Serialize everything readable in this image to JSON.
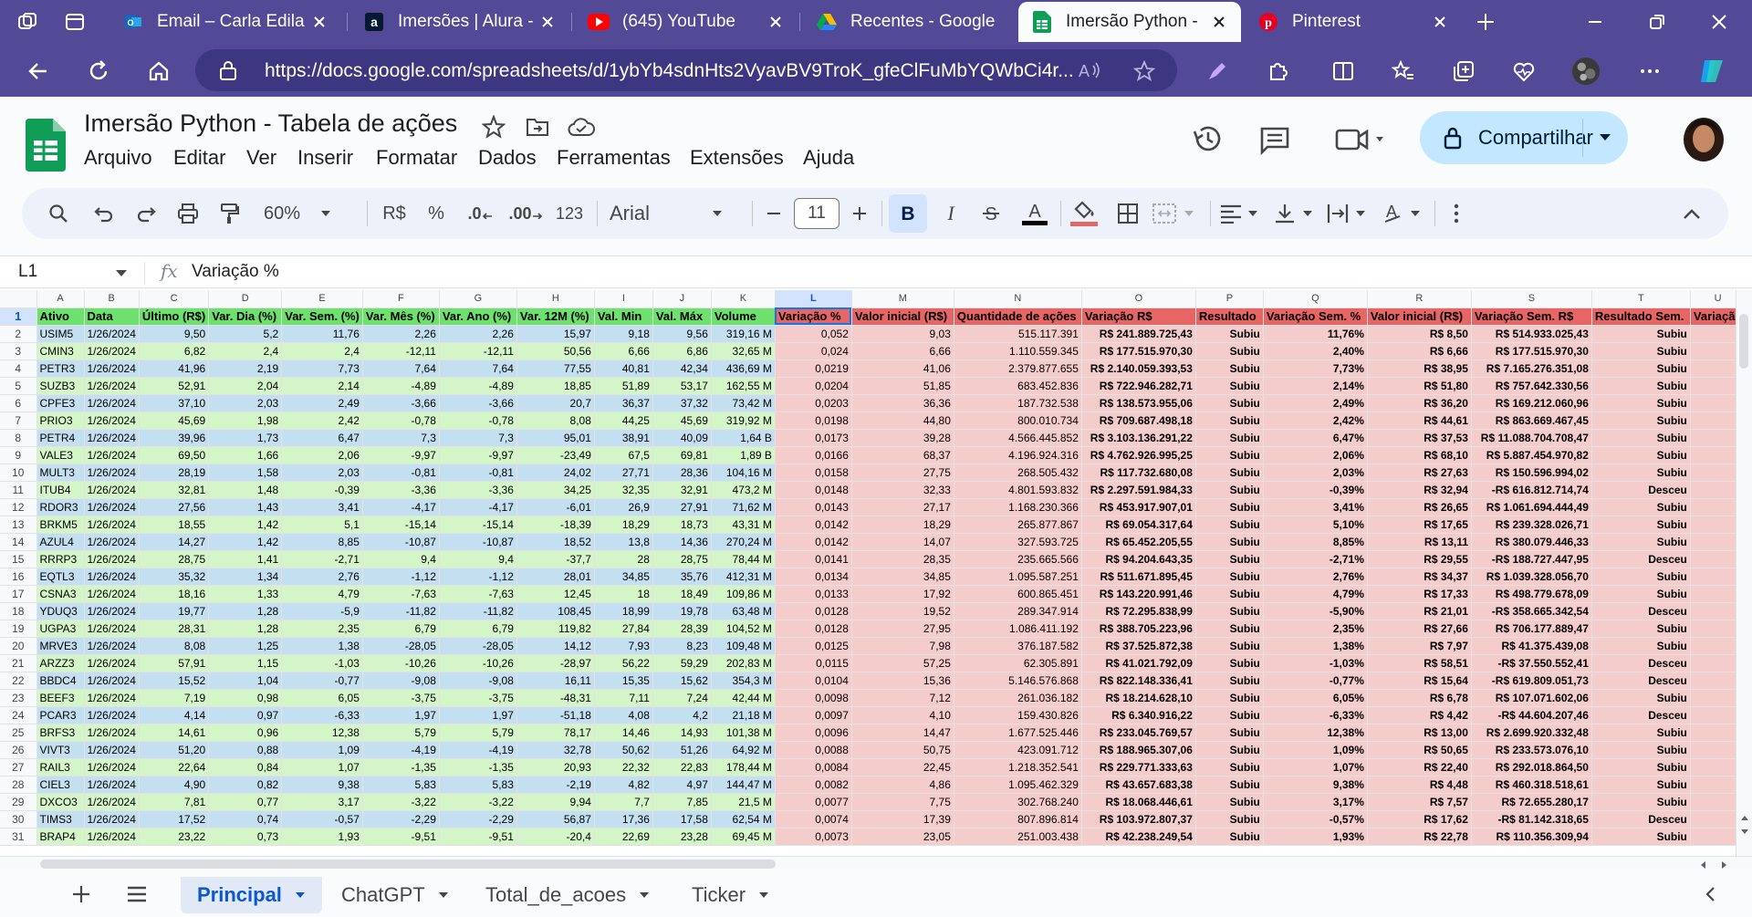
{
  "browser": {
    "tabs": [
      {
        "label": "Email – Carla Edila",
        "icon": "outlook-icon"
      },
      {
        "label": "Imersões | Alura - ",
        "icon": "alura-icon"
      },
      {
        "label": "(645) YouTube",
        "icon": "youtube-icon"
      },
      {
        "label": "Recentes - Google",
        "icon": "drive-icon"
      },
      {
        "label": "Imersão Python - ",
        "icon": "sheets-icon"
      },
      {
        "label": "Pinterest",
        "icon": "pinterest-icon"
      }
    ],
    "url": "https://docs.google.com/spreadsheets/d/1ybYb4sdnHts2VyavBV9TroK_gfeClFuMbYQWbCi4r..."
  },
  "doc": {
    "title": "Imersão Python - Tabela de ações",
    "menu": [
      "Arquivo",
      "Editar",
      "Ver",
      "Inserir",
      "Formatar",
      "Dados",
      "Ferramentas",
      "Extensões",
      "Ajuda"
    ],
    "share_label": "Compartilhar"
  },
  "toolbar": {
    "zoom": "60%",
    "currency": "R$",
    "percent": "%",
    "dec_less": ".0",
    "dec_more": ".00",
    "format_123": "123",
    "font": "Arial",
    "font_size": "11"
  },
  "formula_bar": {
    "cell_ref": "L1",
    "fx": "fx",
    "content": "Variação %"
  },
  "columns": [
    "A",
    "B",
    "C",
    "D",
    "E",
    "F",
    "G",
    "H",
    "I",
    "J",
    "K",
    "L",
    "M",
    "N",
    "O",
    "P",
    "Q",
    "R",
    "S",
    "T",
    "U"
  ],
  "headers": [
    "Ativo",
    "Data",
    "Último (R$)",
    "Var. Dia (%)",
    "Var. Sem. (%)",
    "Var. Mês (%)",
    "Var. Ano (%)",
    "Var. 12M (%)",
    "Val. Min",
    "Val. Máx",
    "Volume",
    "Variação %",
    "Valor inicial (R$)",
    "Quantidade de ações",
    "Variação R$",
    "Resultado",
    "Variação Sem. %",
    "Valor inicial (R$)",
    "Variação Sem. R$",
    "Resultado Sem.",
    "Variação"
  ],
  "rows": [
    [
      "USIM5",
      "1/26/2024",
      "9,50",
      "5,2",
      "11,76",
      "2,26",
      "2,26",
      "15,97",
      "9,18",
      "9,56",
      "319,16 M",
      "0,052",
      "9,03",
      "515.117.391",
      "R$ 241.889.725,43",
      "Subiu",
      "11,76%",
      "R$ 8,50",
      "R$ 514.933.025,43",
      "Subiu"
    ],
    [
      "CMIN3",
      "1/26/2024",
      "6,82",
      "2,4",
      "2,4",
      "-12,11",
      "-12,11",
      "50,56",
      "6,66",
      "6,86",
      "32,65 M",
      "0,024",
      "6,66",
      "1.110.559.345",
      "R$ 177.515.970,30",
      "Subiu",
      "2,40%",
      "R$ 6,66",
      "R$ 177.515.970,30",
      "Subiu"
    ],
    [
      "PETR3",
      "1/26/2024",
      "41,96",
      "2,19",
      "7,73",
      "7,64",
      "7,64",
      "77,55",
      "40,81",
      "42,34",
      "436,69 M",
      "0,0219",
      "41,06",
      "2.379.877.655",
      "R$ 2.140.059.393,53",
      "Subiu",
      "7,73%",
      "R$ 38,95",
      "R$ 7.165.276.351,08",
      "Subiu"
    ],
    [
      "SUZB3",
      "1/26/2024",
      "52,91",
      "2,04",
      "2,14",
      "-4,89",
      "-4,89",
      "18,85",
      "51,89",
      "53,17",
      "162,55 M",
      "0,0204",
      "51,85",
      "683.452.836",
      "R$ 722.946.282,71",
      "Subiu",
      "2,14%",
      "R$ 51,80",
      "R$ 757.642.330,56",
      "Subiu"
    ],
    [
      "CPFE3",
      "1/26/2024",
      "37,10",
      "2,03",
      "2,49",
      "-3,66",
      "-3,66",
      "20,7",
      "36,37",
      "37,32",
      "73,42 M",
      "0,0203",
      "36,36",
      "187.732.538",
      "R$ 138.573.955,06",
      "Subiu",
      "2,49%",
      "R$ 36,20",
      "R$ 169.212.060,96",
      "Subiu"
    ],
    [
      "PRIO3",
      "1/26/2024",
      "45,69",
      "1,98",
      "2,42",
      "-0,78",
      "-0,78",
      "8,08",
      "44,25",
      "45,69",
      "319,92 M",
      "0,0198",
      "44,80",
      "800.010.734",
      "R$ 709.687.498,18",
      "Subiu",
      "2,42%",
      "R$ 44,61",
      "R$ 863.669.467,45",
      "Subiu"
    ],
    [
      "PETR4",
      "1/26/2024",
      "39,96",
      "1,73",
      "6,47",
      "7,3",
      "7,3",
      "95,01",
      "38,91",
      "40,09",
      "1,64 B",
      "0,0173",
      "39,28",
      "4.566.445.852",
      "R$ 3.103.136.291,22",
      "Subiu",
      "6,47%",
      "R$ 37,53",
      "R$ 11.088.704.708,47",
      "Subiu"
    ],
    [
      "VALE3",
      "1/26/2024",
      "69,50",
      "1,66",
      "2,06",
      "-9,97",
      "-9,97",
      "-23,49",
      "67,5",
      "69,81",
      "1,89 B",
      "0,0166",
      "68,37",
      "4.196.924.316",
      "R$ 4.762.926.995,25",
      "Subiu",
      "2,06%",
      "R$ 68,10",
      "R$ 5.887.454.970,82",
      "Subiu"
    ],
    [
      "MULT3",
      "1/26/2024",
      "28,19",
      "1,58",
      "2,03",
      "-0,81",
      "-0,81",
      "24,02",
      "27,71",
      "28,36",
      "104,16 M",
      "0,0158",
      "27,75",
      "268.505.432",
      "R$ 117.732.680,08",
      "Subiu",
      "2,03%",
      "R$ 27,63",
      "R$ 150.596.994,02",
      "Subiu"
    ],
    [
      "ITUB4",
      "1/26/2024",
      "32,81",
      "1,48",
      "-0,39",
      "-3,36",
      "-3,36",
      "34,25",
      "32,35",
      "32,91",
      "473,2 M",
      "0,0148",
      "32,33",
      "4.801.593.832",
      "R$ 2.297.591.984,33",
      "Subiu",
      "-0,39%",
      "R$ 32,94",
      "-R$ 616.812.714,74",
      "Desceu"
    ],
    [
      "RDOR3",
      "1/26/2024",
      "27,56",
      "1,43",
      "3,41",
      "-4,17",
      "-4,17",
      "-6,01",
      "26,9",
      "27,91",
      "71,62 M",
      "0,0143",
      "27,17",
      "1.168.230.366",
      "R$ 453.917.907,01",
      "Subiu",
      "3,41%",
      "R$ 26,65",
      "R$ 1.061.694.444,49",
      "Subiu"
    ],
    [
      "BRKM5",
      "1/26/2024",
      "18,55",
      "1,42",
      "5,1",
      "-15,14",
      "-15,14",
      "-18,39",
      "18,29",
      "18,73",
      "43,31 M",
      "0,0142",
      "18,29",
      "265.877.867",
      "R$ 69.054.317,64",
      "Subiu",
      "5,10%",
      "R$ 17,65",
      "R$ 239.328.026,71",
      "Subiu"
    ],
    [
      "AZUL4",
      "1/26/2024",
      "14,27",
      "1,42",
      "8,85",
      "-10,87",
      "-10,87",
      "18,52",
      "13,8",
      "14,36",
      "270,24 M",
      "0,0142",
      "14,07",
      "327.593.725",
      "R$ 65.452.205,55",
      "Subiu",
      "8,85%",
      "R$ 13,11",
      "R$ 380.079.446,33",
      "Subiu"
    ],
    [
      "RRRP3",
      "1/26/2024",
      "28,75",
      "1,41",
      "-2,71",
      "9,4",
      "9,4",
      "-37,7",
      "28",
      "28,75",
      "78,44 M",
      "0,0141",
      "28,35",
      "235.665.566",
      "R$ 94.204.643,35",
      "Subiu",
      "-2,71%",
      "R$ 29,55",
      "-R$ 188.727.447,95",
      "Desceu"
    ],
    [
      "EQTL3",
      "1/26/2024",
      "35,32",
      "1,34",
      "2,76",
      "-1,12",
      "-1,12",
      "28,01",
      "34,85",
      "35,76",
      "412,31 M",
      "0,0134",
      "34,85",
      "1.095.587.251",
      "R$ 511.671.895,45",
      "Subiu",
      "2,76%",
      "R$ 34,37",
      "R$ 1.039.328.056,70",
      "Subiu"
    ],
    [
      "CSNA3",
      "1/26/2024",
      "18,16",
      "1,33",
      "4,79",
      "-7,63",
      "-7,63",
      "12,45",
      "18",
      "18,49",
      "109,86 M",
      "0,0133",
      "17,92",
      "600.865.451",
      "R$ 143.220.991,46",
      "Subiu",
      "4,79%",
      "R$ 17,33",
      "R$ 498.779.678,09",
      "Subiu"
    ],
    [
      "YDUQ3",
      "1/26/2024",
      "19,77",
      "1,28",
      "-5,9",
      "-11,82",
      "-11,82",
      "108,45",
      "18,99",
      "19,78",
      "63,48 M",
      "0,0128",
      "19,52",
      "289.347.914",
      "R$ 72.295.838,99",
      "Subiu",
      "-5,90%",
      "R$ 21,01",
      "-R$ 358.665.342,54",
      "Desceu"
    ],
    [
      "UGPA3",
      "1/26/2024",
      "28,31",
      "1,28",
      "2,35",
      "6,79",
      "6,79",
      "119,82",
      "27,84",
      "28,39",
      "104,52 M",
      "0,0128",
      "27,95",
      "1.086.411.192",
      "R$ 388.705.223,96",
      "Subiu",
      "2,35%",
      "R$ 27,66",
      "R$ 706.177.889,47",
      "Subiu"
    ],
    [
      "MRVE3",
      "1/26/2024",
      "8,08",
      "1,25",
      "1,38",
      "-28,05",
      "-28,05",
      "14,12",
      "7,93",
      "8,23",
      "109,48 M",
      "0,0125",
      "7,98",
      "376.187.582",
      "R$ 37.525.872,38",
      "Subiu",
      "1,38%",
      "R$ 7,97",
      "R$ 41.375.439,08",
      "Subiu"
    ],
    [
      "ARZZ3",
      "1/26/2024",
      "57,91",
      "1,15",
      "-1,03",
      "-10,26",
      "-10,26",
      "-28,97",
      "56,22",
      "59,29",
      "202,83 M",
      "0,0115",
      "57,25",
      "62.305.891",
      "R$ 41.021.792,09",
      "Subiu",
      "-1,03%",
      "R$ 58,51",
      "-R$ 37.550.552,41",
      "Desceu"
    ],
    [
      "BBDC4",
      "1/26/2024",
      "15,52",
      "1,04",
      "-0,77",
      "-9,08",
      "-9,08",
      "16,11",
      "15,35",
      "15,62",
      "354,3 M",
      "0,0104",
      "15,36",
      "5.146.576.868",
      "R$ 822.148.336,41",
      "Subiu",
      "-0,77%",
      "R$ 15,64",
      "-R$ 619.809.051,73",
      "Desceu"
    ],
    [
      "BEEF3",
      "1/26/2024",
      "7,19",
      "0,98",
      "6,05",
      "-3,75",
      "-3,75",
      "-48,31",
      "7,11",
      "7,24",
      "42,44 M",
      "0,0098",
      "7,12",
      "261.036.182",
      "R$ 18.214.628,10",
      "Subiu",
      "6,05%",
      "R$ 6,78",
      "R$ 107.071.602,06",
      "Subiu"
    ],
    [
      "PCAR3",
      "1/26/2024",
      "4,14",
      "0,97",
      "-6,33",
      "1,97",
      "1,97",
      "-51,18",
      "4,08",
      "4,2",
      "21,18 M",
      "0,0097",
      "4,10",
      "159.430.826",
      "R$ 6.340.916,22",
      "Subiu",
      "-6,33%",
      "R$ 4,42",
      "-R$ 44.604.207,46",
      "Desceu"
    ],
    [
      "BRFS3",
      "1/26/2024",
      "14,61",
      "0,96",
      "12,38",
      "5,79",
      "5,79",
      "78,17",
      "14,46",
      "14,93",
      "101,38 M",
      "0,0096",
      "14,47",
      "1.677.525.446",
      "R$ 233.045.769,57",
      "Subiu",
      "12,38%",
      "R$ 13,00",
      "R$ 2.699.920.332,48",
      "Subiu"
    ],
    [
      "VIVT3",
      "1/26/2024",
      "51,20",
      "0,88",
      "1,09",
      "-4,19",
      "-4,19",
      "32,78",
      "50,62",
      "51,26",
      "64,92 M",
      "0,0088",
      "50,75",
      "423.091.712",
      "R$ 188.965.307,06",
      "Subiu",
      "1,09%",
      "R$ 50,65",
      "R$ 233.573.076,10",
      "Subiu"
    ],
    [
      "RAIL3",
      "1/26/2024",
      "22,64",
      "0,84",
      "1,07",
      "-1,35",
      "-1,35",
      "20,93",
      "22,32",
      "22,83",
      "178,44 M",
      "0,0084",
      "22,45",
      "1.218.352.541",
      "R$ 229.771.333,63",
      "Subiu",
      "1,07%",
      "R$ 22,40",
      "R$ 292.018.864,50",
      "Subiu"
    ],
    [
      "CIEL3",
      "1/26/2024",
      "4,90",
      "0,82",
      "9,38",
      "5,83",
      "5,83",
      "-2,19",
      "4,82",
      "4,97",
      "144,47 M",
      "0,0082",
      "4,86",
      "1.095.462.329",
      "R$ 43.657.683,38",
      "Subiu",
      "9,38%",
      "R$ 4,48",
      "R$ 460.318.518,61",
      "Subiu"
    ],
    [
      "DXCO3",
      "1/26/2024",
      "7,81",
      "0,77",
      "3,17",
      "-3,22",
      "-3,22",
      "9,94",
      "7,7",
      "7,85",
      "21,5 M",
      "0,0077",
      "7,75",
      "302.768.240",
      "R$ 18.068.446,61",
      "Subiu",
      "3,17%",
      "R$ 7,57",
      "R$ 72.655.280,17",
      "Subiu"
    ],
    [
      "TIMS3",
      "1/26/2024",
      "17,52",
      "0,74",
      "-0,57",
      "-2,29",
      "-2,29",
      "56,87",
      "17,36",
      "17,58",
      "62,54 M",
      "0,0074",
      "17,39",
      "807.896.814",
      "R$ 103.972.807,37",
      "Subiu",
      "-0,57%",
      "R$ 17,62",
      "-R$ 81.142.318,65",
      "Desceu"
    ],
    [
      "BRAP4",
      "1/26/2024",
      "23,22",
      "0,73",
      "1,93",
      "-9,51",
      "-9,51",
      "-20,4",
      "22,69",
      "23,28",
      "69,45 M",
      "0,0073",
      "23,05",
      "251.003.438",
      "R$ 42.238.249,54",
      "Subiu",
      "1,93%",
      "R$ 22,78",
      "R$ 110.356.309,94",
      "Subiu"
    ]
  ],
  "sheet_tabs": [
    "Principal",
    "ChatGPT",
    "Total_de_acoes",
    "Ticker"
  ],
  "colors": {
    "chrome": "#524a96",
    "green_header": "#6ee06e",
    "red_header": "#e66565",
    "blue_row": "#c4dff0",
    "green_row": "#d4f5c8",
    "pink_cell": "#f4cccc",
    "share": "#c2e7ff"
  }
}
